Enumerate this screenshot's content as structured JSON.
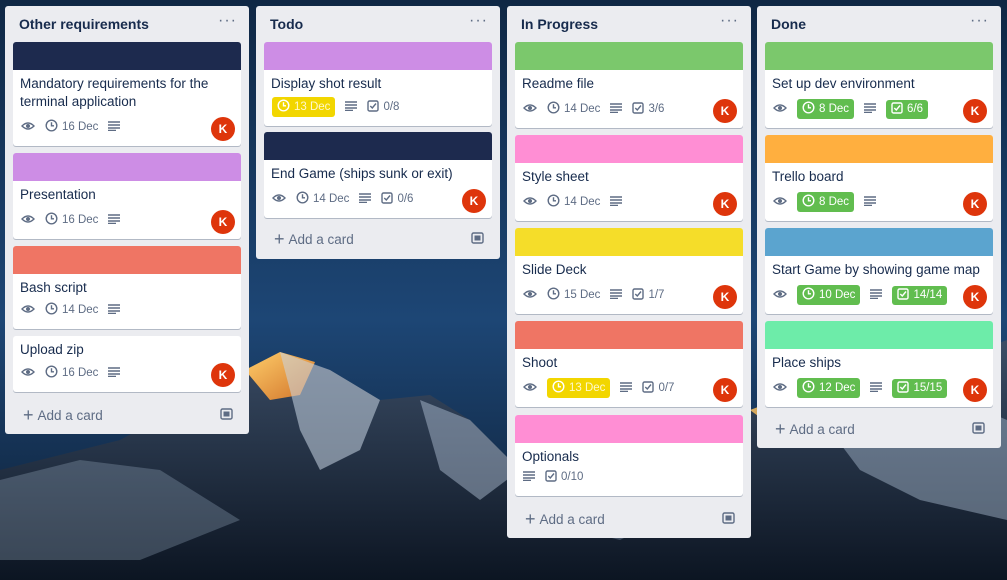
{
  "colors": {
    "navy": "#1d2a4e",
    "purple": "#cd8de5",
    "salmon": "#ef7564",
    "green": "#7bc86c",
    "pink": "#ff8ed4",
    "yellow": "#f5dd29",
    "orange": "#ffaf3f",
    "blue": "#5ba4cf",
    "mint": "#6deca9",
    "date_yellow": "#f2d600",
    "date_green": "#61bd4f",
    "avatar": "#de350b"
  },
  "lists": [
    {
      "title": "Other requirements",
      "menu": "···",
      "add_card": "Add a card",
      "cards": [
        {
          "cover": "navy",
          "title": "Mandatory requirements for the terminal application",
          "date": "16 Dec",
          "avatar": "K"
        },
        {
          "cover": "purple",
          "title": "Presentation",
          "date": "16 Dec",
          "avatar": "K"
        },
        {
          "cover": "salmon",
          "title": "Bash script",
          "date": "14 Dec"
        },
        {
          "title": "Upload zip",
          "date": "16 Dec",
          "avatar": "K"
        }
      ]
    },
    {
      "title": "Todo",
      "menu": "···",
      "add_card": "Add a card",
      "cards": [
        {
          "cover": "purple",
          "title": "Display shot result",
          "date": "13 Dec",
          "checklist": "0/8"
        },
        {
          "cover": "navy",
          "title": "End Game (ships sunk or exit)",
          "date": "14 Dec",
          "checklist": "0/6",
          "avatar": "K"
        }
      ]
    },
    {
      "title": "In Progress",
      "menu": "···",
      "add_card": "Add a card",
      "cards": [
        {
          "cover": "green",
          "title": "Readme file",
          "date": "14 Dec",
          "checklist": "3/6",
          "avatar": "K"
        },
        {
          "cover": "pink",
          "title": "Style sheet",
          "date": "14 Dec",
          "avatar": "K"
        },
        {
          "cover": "yellow",
          "title": "Slide Deck",
          "date": "15 Dec",
          "checklist": "1/7",
          "avatar": "K"
        },
        {
          "cover": "salmon",
          "title": "Shoot",
          "date": "13 Dec",
          "checklist": "0/7",
          "avatar": "K"
        },
        {
          "cover": "pink",
          "title": "Optionals",
          "checklist": "0/10"
        }
      ]
    },
    {
      "title": "Done",
      "menu": "···",
      "add_card": "Add a card",
      "cards": [
        {
          "cover": "green",
          "title": "Set up dev environment",
          "date": "8 Dec",
          "checklist": "6/6",
          "avatar": "K"
        },
        {
          "cover": "orange",
          "title": "Trello board",
          "date": "8 Dec",
          "avatar": "K"
        },
        {
          "cover": "blue",
          "title": "Start Game by showing game map",
          "date": "10 Dec",
          "checklist": "14/14",
          "avatar": "K"
        },
        {
          "cover": "mint",
          "title": "Place ships",
          "date": "12 Dec",
          "checklist": "15/15",
          "avatar": "K"
        }
      ]
    }
  ]
}
